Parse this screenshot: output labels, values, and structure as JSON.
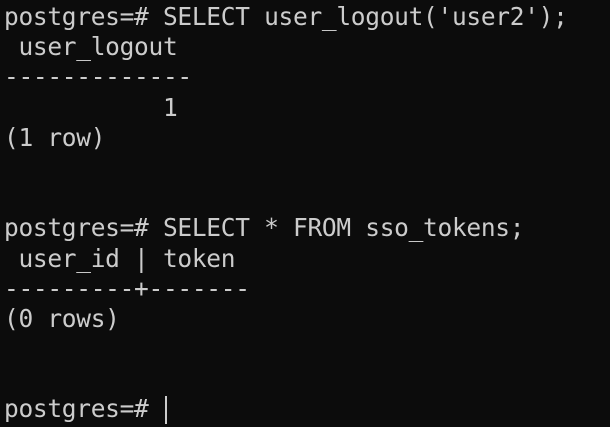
{
  "terminal": {
    "lines": [
      "postgres=# SELECT user_logout('user2');",
      " user_logout",
      "-------------",
      "           1",
      "(1 row)",
      "",
      "",
      "postgres=# SELECT * FROM sso_tokens;",
      " user_id | token",
      "---------+-------",
      "(0 rows)",
      "",
      "",
      "postgres=# "
    ],
    "colors": {
      "background": "#0c0c0c",
      "foreground": "#cccccc"
    }
  }
}
